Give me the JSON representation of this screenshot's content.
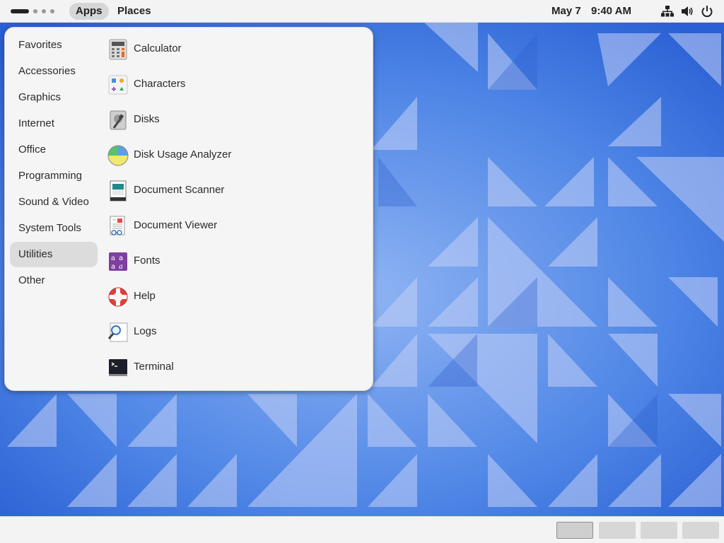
{
  "topbar": {
    "apps_label": "Apps",
    "places_label": "Places",
    "date": "May 7",
    "time": "9:40 AM"
  },
  "menu": {
    "categories": [
      {
        "label": "Favorites",
        "selected": false
      },
      {
        "label": "Accessories",
        "selected": false
      },
      {
        "label": "Graphics",
        "selected": false
      },
      {
        "label": "Internet",
        "selected": false
      },
      {
        "label": "Office",
        "selected": false
      },
      {
        "label": "Programming",
        "selected": false
      },
      {
        "label": "Sound & Video",
        "selected": false
      },
      {
        "label": "System Tools",
        "selected": false
      },
      {
        "label": "Utilities",
        "selected": true
      },
      {
        "label": "Other",
        "selected": false
      }
    ],
    "apps": [
      {
        "label": "Calculator",
        "icon": "calculator-icon"
      },
      {
        "label": "Characters",
        "icon": "characters-icon"
      },
      {
        "label": "Disks",
        "icon": "disks-icon"
      },
      {
        "label": "Disk Usage Analyzer",
        "icon": "disk-usage-analyzer-icon"
      },
      {
        "label": "Document Scanner",
        "icon": "document-scanner-icon"
      },
      {
        "label": "Document Viewer",
        "icon": "document-viewer-icon"
      },
      {
        "label": "Fonts",
        "icon": "fonts-icon"
      },
      {
        "label": "Help",
        "icon": "help-icon"
      },
      {
        "label": "Logs",
        "icon": "logs-icon"
      },
      {
        "label": "Terminal",
        "icon": "terminal-icon"
      }
    ]
  },
  "system_icons": [
    "network-icon",
    "volume-icon",
    "power-icon"
  ],
  "workspaces": {
    "count": 4,
    "active": 1
  },
  "colors": {
    "wallpaper_base": "#3f78dd",
    "bar_background": "#f3f3f3",
    "selected_category": "#dcdcdc"
  }
}
